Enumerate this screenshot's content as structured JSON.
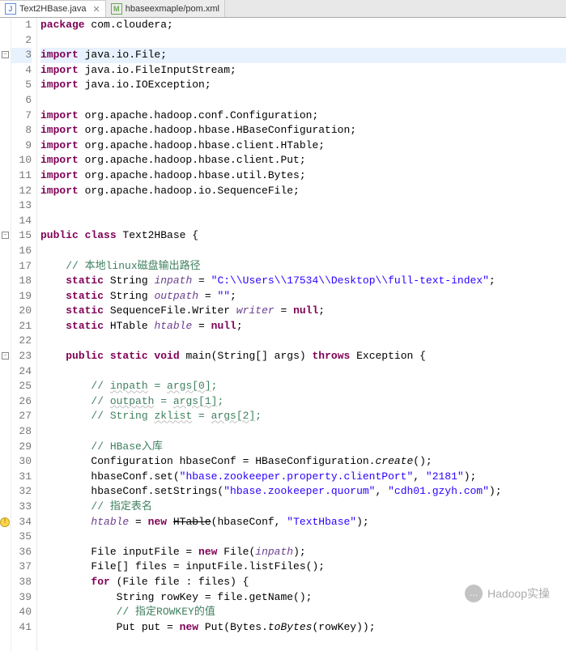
{
  "tabs": [
    {
      "label": "Text2HBase.java",
      "active": true,
      "icon": "J",
      "iconColor": "#5b8fd6"
    },
    {
      "label": "hbaseexmaple/pom.xml",
      "active": false,
      "icon": "M",
      "iconColor": "#6aa84f"
    }
  ],
  "close_glyph": "✕",
  "watermark": {
    "icon": "…",
    "text": "Hadoop实操"
  },
  "fold_glyph": "−",
  "warn_glyph": "!",
  "lines": [
    {
      "n": 1,
      "tokens": [
        {
          "t": "package ",
          "c": "kw"
        },
        {
          "t": "com.cloudera;"
        }
      ]
    },
    {
      "n": 2,
      "tokens": []
    },
    {
      "n": 3,
      "hl": true,
      "fold": true,
      "tokens": [
        {
          "t": "import ",
          "c": "kw"
        },
        {
          "t": "java.io.File;"
        }
      ]
    },
    {
      "n": 4,
      "tokens": [
        {
          "t": "import ",
          "c": "kw"
        },
        {
          "t": "java.io.FileInputStream;"
        }
      ]
    },
    {
      "n": 5,
      "tokens": [
        {
          "t": "import ",
          "c": "kw"
        },
        {
          "t": "java.io.IOException;"
        }
      ]
    },
    {
      "n": 6,
      "tokens": []
    },
    {
      "n": 7,
      "tokens": [
        {
          "t": "import ",
          "c": "kw"
        },
        {
          "t": "org.apache.hadoop.conf.Configuration;"
        }
      ]
    },
    {
      "n": 8,
      "tokens": [
        {
          "t": "import ",
          "c": "kw"
        },
        {
          "t": "org.apache.hadoop.hbase.HBaseConfiguration;"
        }
      ]
    },
    {
      "n": 9,
      "tokens": [
        {
          "t": "import ",
          "c": "kw"
        },
        {
          "t": "org.apache.hadoop.hbase.client.HTable;"
        }
      ]
    },
    {
      "n": 10,
      "tokens": [
        {
          "t": "import ",
          "c": "kw"
        },
        {
          "t": "org.apache.hadoop.hbase.client.Put;"
        }
      ]
    },
    {
      "n": 11,
      "tokens": [
        {
          "t": "import ",
          "c": "kw"
        },
        {
          "t": "org.apache.hadoop.hbase.util.Bytes;"
        }
      ]
    },
    {
      "n": 12,
      "tokens": [
        {
          "t": "import ",
          "c": "kw"
        },
        {
          "t": "org.apache.hadoop.io.SequenceFile;"
        }
      ]
    },
    {
      "n": 13,
      "tokens": []
    },
    {
      "n": 14,
      "tokens": []
    },
    {
      "n": 15,
      "fold": true,
      "tokens": [
        {
          "t": "public class ",
          "c": "kw"
        },
        {
          "t": "Text2HBase {"
        }
      ]
    },
    {
      "n": 16,
      "tokens": []
    },
    {
      "n": 17,
      "tokens": [
        {
          "t": "    "
        },
        {
          "t": "// 本地linux磁盘输出路径",
          "c": "com"
        }
      ]
    },
    {
      "n": 18,
      "tokens": [
        {
          "t": "    "
        },
        {
          "t": "static ",
          "c": "kw"
        },
        {
          "t": "String "
        },
        {
          "t": "inpath",
          "c": "sfield"
        },
        {
          "t": " = "
        },
        {
          "t": "\"C:\\\\Users\\\\17534\\\\Desktop\\\\full-text-index\"",
          "c": "str"
        },
        {
          "t": ";"
        }
      ]
    },
    {
      "n": 19,
      "tokens": [
        {
          "t": "    "
        },
        {
          "t": "static ",
          "c": "kw"
        },
        {
          "t": "String "
        },
        {
          "t": "outpath",
          "c": "sfield"
        },
        {
          "t": " = "
        },
        {
          "t": "\"\"",
          "c": "str"
        },
        {
          "t": ";"
        }
      ]
    },
    {
      "n": 20,
      "tokens": [
        {
          "t": "    "
        },
        {
          "t": "static ",
          "c": "kw"
        },
        {
          "t": "SequenceFile.Writer "
        },
        {
          "t": "writer",
          "c": "sfield"
        },
        {
          "t": " = "
        },
        {
          "t": "null",
          "c": "kw"
        },
        {
          "t": ";"
        }
      ]
    },
    {
      "n": 21,
      "tokens": [
        {
          "t": "    "
        },
        {
          "t": "static ",
          "c": "kw"
        },
        {
          "t": "HTable "
        },
        {
          "t": "htable",
          "c": "sfield"
        },
        {
          "t": " = "
        },
        {
          "t": "null",
          "c": "kw"
        },
        {
          "t": ";"
        }
      ]
    },
    {
      "n": 22,
      "tokens": []
    },
    {
      "n": 23,
      "fold": true,
      "tokens": [
        {
          "t": "    "
        },
        {
          "t": "public static void ",
          "c": "kw"
        },
        {
          "t": "main(String[] args) "
        },
        {
          "t": "throws ",
          "c": "kw"
        },
        {
          "t": "Exception {"
        }
      ]
    },
    {
      "n": 24,
      "tokens": []
    },
    {
      "n": 25,
      "tokens": [
        {
          "t": "        "
        },
        {
          "t": "// ",
          "c": "com"
        },
        {
          "t": "inpath",
          "c": "com wavy"
        },
        {
          "t": " = ",
          "c": "com"
        },
        {
          "t": "args[0]",
          "c": "com wavy"
        },
        {
          "t": ";",
          "c": "com"
        }
      ]
    },
    {
      "n": 26,
      "tokens": [
        {
          "t": "        "
        },
        {
          "t": "// ",
          "c": "com"
        },
        {
          "t": "outpath",
          "c": "com wavy"
        },
        {
          "t": " = ",
          "c": "com"
        },
        {
          "t": "args[1]",
          "c": "com wavy"
        },
        {
          "t": ";",
          "c": "com"
        }
      ]
    },
    {
      "n": 27,
      "tokens": [
        {
          "t": "        "
        },
        {
          "t": "// String ",
          "c": "com"
        },
        {
          "t": "zklist",
          "c": "com wavy"
        },
        {
          "t": " = ",
          "c": "com"
        },
        {
          "t": "args[2]",
          "c": "com wavy"
        },
        {
          "t": ";",
          "c": "com"
        }
      ]
    },
    {
      "n": 28,
      "tokens": []
    },
    {
      "n": 29,
      "tokens": [
        {
          "t": "        "
        },
        {
          "t": "// HBase入库",
          "c": "com"
        }
      ]
    },
    {
      "n": 30,
      "tokens": [
        {
          "t": "        Configuration hbaseConf = HBaseConfiguration."
        },
        {
          "t": "create",
          "c": "staticcall"
        },
        {
          "t": "();"
        }
      ]
    },
    {
      "n": 31,
      "tokens": [
        {
          "t": "        hbaseConf.set("
        },
        {
          "t": "\"hbase.zookeeper.property.clientPort\"",
          "c": "str"
        },
        {
          "t": ", "
        },
        {
          "t": "\"2181\"",
          "c": "str"
        },
        {
          "t": ");"
        }
      ]
    },
    {
      "n": 32,
      "tokens": [
        {
          "t": "        hbaseConf.setStrings("
        },
        {
          "t": "\"hbase.zookeeper.quorum\"",
          "c": "str"
        },
        {
          "t": ", "
        },
        {
          "t": "\"cdh01.gzyh.com\"",
          "c": "str"
        },
        {
          "t": ");"
        }
      ]
    },
    {
      "n": 33,
      "tokens": [
        {
          "t": "        "
        },
        {
          "t": "// 指定表名",
          "c": "com"
        }
      ]
    },
    {
      "n": 34,
      "warn": true,
      "tokens": [
        {
          "t": "        "
        },
        {
          "t": "htable",
          "c": "sfield"
        },
        {
          "t": " = "
        },
        {
          "t": "new ",
          "c": "kw"
        },
        {
          "t": "HTable",
          "c": "depr"
        },
        {
          "t": "(hbaseConf, "
        },
        {
          "t": "\"TextHbase\"",
          "c": "str"
        },
        {
          "t": ");"
        }
      ]
    },
    {
      "n": 35,
      "tokens": []
    },
    {
      "n": 36,
      "tokens": [
        {
          "t": "        File inputFile = "
        },
        {
          "t": "new ",
          "c": "kw"
        },
        {
          "t": "File("
        },
        {
          "t": "inpath",
          "c": "sfield"
        },
        {
          "t": ");"
        }
      ]
    },
    {
      "n": 37,
      "tokens": [
        {
          "t": "        File[] files = inputFile.listFiles();"
        }
      ]
    },
    {
      "n": 38,
      "tokens": [
        {
          "t": "        "
        },
        {
          "t": "for ",
          "c": "kw"
        },
        {
          "t": "(File file : files) {"
        }
      ]
    },
    {
      "n": 39,
      "tokens": [
        {
          "t": "            String rowKey = file.getName();"
        }
      ]
    },
    {
      "n": 40,
      "tokens": [
        {
          "t": "            "
        },
        {
          "t": "// 指定ROWKEY的值",
          "c": "com"
        }
      ]
    },
    {
      "n": 41,
      "tokens": [
        {
          "t": "            Put put = "
        },
        {
          "t": "new ",
          "c": "kw"
        },
        {
          "t": "Put(Bytes."
        },
        {
          "t": "toBytes",
          "c": "staticcall"
        },
        {
          "t": "(rowKey));"
        }
      ]
    }
  ]
}
